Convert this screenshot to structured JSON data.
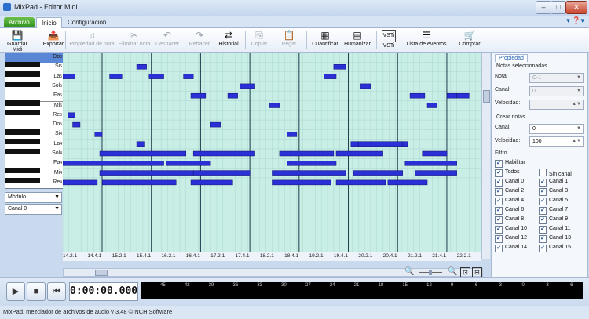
{
  "window": {
    "title": "MixPad - Editor Midi",
    "minimize": "–",
    "maximize": "□",
    "close": "✕"
  },
  "tabs": [
    {
      "label": "Archivo"
    },
    {
      "label": "Inicio"
    },
    {
      "label": "Configuración"
    }
  ],
  "help_icons": "▾ ❓▾",
  "toolbar": [
    {
      "label": "Guardar Midi",
      "icon": "save-icon",
      "glyph": "💾",
      "disabled": false
    },
    {
      "label": "Exportar",
      "icon": "export-icon",
      "glyph": "📤",
      "disabled": false
    },
    {
      "label": "Propiedad de nota",
      "icon": "note-property-icon",
      "glyph": "♫",
      "disabled": true
    },
    {
      "label": "Eliminar nota",
      "icon": "delete-note-icon",
      "glyph": "✂",
      "disabled": true
    },
    {
      "label": "Deshacer",
      "icon": "undo-icon",
      "glyph": "↶",
      "disabled": true
    },
    {
      "label": "Rehacer",
      "icon": "redo-icon",
      "glyph": "↷",
      "disabled": true
    },
    {
      "label": "Historial",
      "icon": "history-icon",
      "glyph": "⇄",
      "disabled": false
    },
    {
      "label": "Copiar",
      "icon": "copy-icon",
      "glyph": "⎘",
      "disabled": true
    },
    {
      "label": "Pegar",
      "icon": "paste-icon",
      "glyph": "📋",
      "disabled": true
    },
    {
      "label": "Cuantificar",
      "icon": "quantize-icon",
      "glyph": "▦",
      "disabled": false
    },
    {
      "label": "Humanizar",
      "icon": "humanize-icon",
      "glyph": "▤",
      "disabled": false
    },
    {
      "label": "VSTi",
      "icon": "vsti-icon",
      "glyph": "VSTi",
      "disabled": false
    },
    {
      "label": "Lista de eventos",
      "icon": "event-list-icon",
      "glyph": "☰",
      "disabled": false
    },
    {
      "label": "Comprar",
      "icon": "buy-icon",
      "glyph": "🛒",
      "disabled": false
    }
  ],
  "piano_notes": [
    {
      "name": "Do",
      "octave": "6"
    },
    {
      "name": "Si",
      "octave": "5"
    },
    {
      "name": "La",
      "octave": "5"
    },
    {
      "name": "Sol",
      "octave": "5"
    },
    {
      "name": "Fa",
      "octave": "5"
    },
    {
      "name": "Mi",
      "octave": "5"
    },
    {
      "name": "Re",
      "octave": "5"
    },
    {
      "name": "Do",
      "octave": "5"
    },
    {
      "name": "Si",
      "octave": "4"
    },
    {
      "name": "La",
      "octave": "4"
    },
    {
      "name": "Sol",
      "octave": "4"
    },
    {
      "name": "Fa",
      "octave": "4"
    },
    {
      "name": "Mi",
      "octave": "4"
    },
    {
      "name": "Re",
      "octave": "4"
    }
  ],
  "left_controls": {
    "mode": "Módulo",
    "channel": "Canal 0"
  },
  "timeline_labels": [
    "14.2.1",
    "14.4.1",
    "15.2.1",
    "15.4.1",
    "16.2.1",
    "16.4.1",
    "17.2.1",
    "17.4.1",
    "18.2.1",
    "18.4.1",
    "19.2.1",
    "19.4.1",
    "20.2.1",
    "20.4.1",
    "21.2.1",
    "21.4.1",
    "22.2.1"
  ],
  "properties": {
    "tab": "Propiedad",
    "selected_heading": "Notas seleccionadas",
    "nota_label": "Nota:",
    "nota_value": "C-1",
    "canal_label": "Canal:",
    "canal_value": "0",
    "velocidad_label": "Velocidad:",
    "velocidad_value": "",
    "create_heading": "Crear notas",
    "create_canal_label": "Canal:",
    "create_canal_value": "0",
    "create_velocidad_label": "Velocidad:",
    "create_velocidad_value": "100",
    "filter_heading": "Filtro",
    "habilitar": "Habilitar",
    "todos": "Todos",
    "sin_canal": "Sin canal",
    "channels": [
      {
        "label": "Canal  0",
        "checked": true
      },
      {
        "label": "Canal  1",
        "checked": true
      },
      {
        "label": "Canal  2",
        "checked": true
      },
      {
        "label": "Canal  3",
        "checked": true
      },
      {
        "label": "Canal  4",
        "checked": true
      },
      {
        "label": "Canal  5",
        "checked": true
      },
      {
        "label": "Canal  6",
        "checked": true
      },
      {
        "label": "Canal  7",
        "checked": true
      },
      {
        "label": "Canal  8",
        "checked": true
      },
      {
        "label": "Canal  9",
        "checked": true
      },
      {
        "label": "Canal 10",
        "checked": true
      },
      {
        "label": "Canal 11",
        "checked": true
      },
      {
        "label": "Canal 12",
        "checked": true
      },
      {
        "label": "Canal 13",
        "checked": true
      },
      {
        "label": "Canal 14",
        "checked": true
      },
      {
        "label": "Canal 15",
        "checked": true
      }
    ]
  },
  "transport": {
    "time": "0:00:00.000",
    "meter_labels": [
      "-45",
      "-42",
      "-39",
      "-36",
      "-33",
      "-30",
      "-27",
      "-24",
      "-21",
      "-18",
      "-15",
      "-12",
      "-9",
      "-6",
      "-3",
      "0",
      "3",
      "6"
    ]
  },
  "status": "MixPad, mezclador de archivos de audio v 3.48 © NCH Software",
  "notes": [
    {
      "row": 2,
      "start": 0.0,
      "len": 0.5
    },
    {
      "row": 2,
      "start": 1.9,
      "len": 0.5
    },
    {
      "row": 1,
      "start": 3.0,
      "len": 0.4
    },
    {
      "row": 2,
      "start": 3.5,
      "len": 0.6
    },
    {
      "row": 2,
      "start": 4.9,
      "len": 0.4
    },
    {
      "row": 4,
      "start": 5.2,
      "len": 0.6
    },
    {
      "row": 4,
      "start": 6.7,
      "len": 0.4
    },
    {
      "row": 2,
      "start": 10.6,
      "len": 0.5
    },
    {
      "row": 1,
      "start": 11.0,
      "len": 0.5
    },
    {
      "row": 3,
      "start": 12.1,
      "len": 0.4
    },
    {
      "row": 4,
      "start": 14.1,
      "len": 0.6
    },
    {
      "row": 4,
      "start": 15.6,
      "len": 0.4
    },
    {
      "row": 5,
      "start": 14.8,
      "len": 0.4
    },
    {
      "row": 3,
      "start": 7.2,
      "len": 0.6
    },
    {
      "row": 5,
      "start": 8.4,
      "len": 0.4
    },
    {
      "row": 4,
      "start": 16.0,
      "len": 0.5
    },
    {
      "row": 6,
      "start": 0.2,
      "len": 0.3
    },
    {
      "row": 7,
      "start": 0.4,
      "len": 0.3
    },
    {
      "row": 8,
      "start": 1.3,
      "len": 0.3
    },
    {
      "row": 9,
      "start": 3.0,
      "len": 0.3
    },
    {
      "row": 8,
      "start": 9.1,
      "len": 0.4
    },
    {
      "row": 9,
      "start": 11.7,
      "len": 0.3
    },
    {
      "row": 9,
      "start": 13.7,
      "len": 0.3
    },
    {
      "row": 7,
      "start": 6.0,
      "len": 0.4
    },
    {
      "row": 10,
      "start": 1.5,
      "len": 3.5
    },
    {
      "row": 10,
      "start": 5.3,
      "len": 2.5
    },
    {
      "row": 10,
      "start": 8.8,
      "len": 2.2
    },
    {
      "row": 10,
      "start": 11.1,
      "len": 1.9
    },
    {
      "row": 9,
      "start": 12.0,
      "len": 1.8
    },
    {
      "row": 10,
      "start": 14.6,
      "len": 1.0
    },
    {
      "row": 11,
      "start": 0.0,
      "len": 4.1
    },
    {
      "row": 11,
      "start": 4.2,
      "len": 1.8
    },
    {
      "row": 11,
      "start": 9.1,
      "len": 2.0
    },
    {
      "row": 11,
      "start": 13.9,
      "len": 2.1
    },
    {
      "row": 12,
      "start": 1.5,
      "len": 3.8
    },
    {
      "row": 12,
      "start": 5.3,
      "len": 2.3
    },
    {
      "row": 12,
      "start": 8.5,
      "len": 3.0
    },
    {
      "row": 12,
      "start": 11.8,
      "len": 2.0
    },
    {
      "row": 12,
      "start": 14.3,
      "len": 1.7
    },
    {
      "row": 13,
      "start": 0.0,
      "len": 1.4
    },
    {
      "row": 13,
      "start": 1.6,
      "len": 3.0
    },
    {
      "row": 13,
      "start": 5.2,
      "len": 1.7
    },
    {
      "row": 13,
      "start": 8.5,
      "len": 2.4
    },
    {
      "row": 13,
      "start": 11.1,
      "len": 2.0
    },
    {
      "row": 13,
      "start": 13.2,
      "len": 1.6
    }
  ]
}
